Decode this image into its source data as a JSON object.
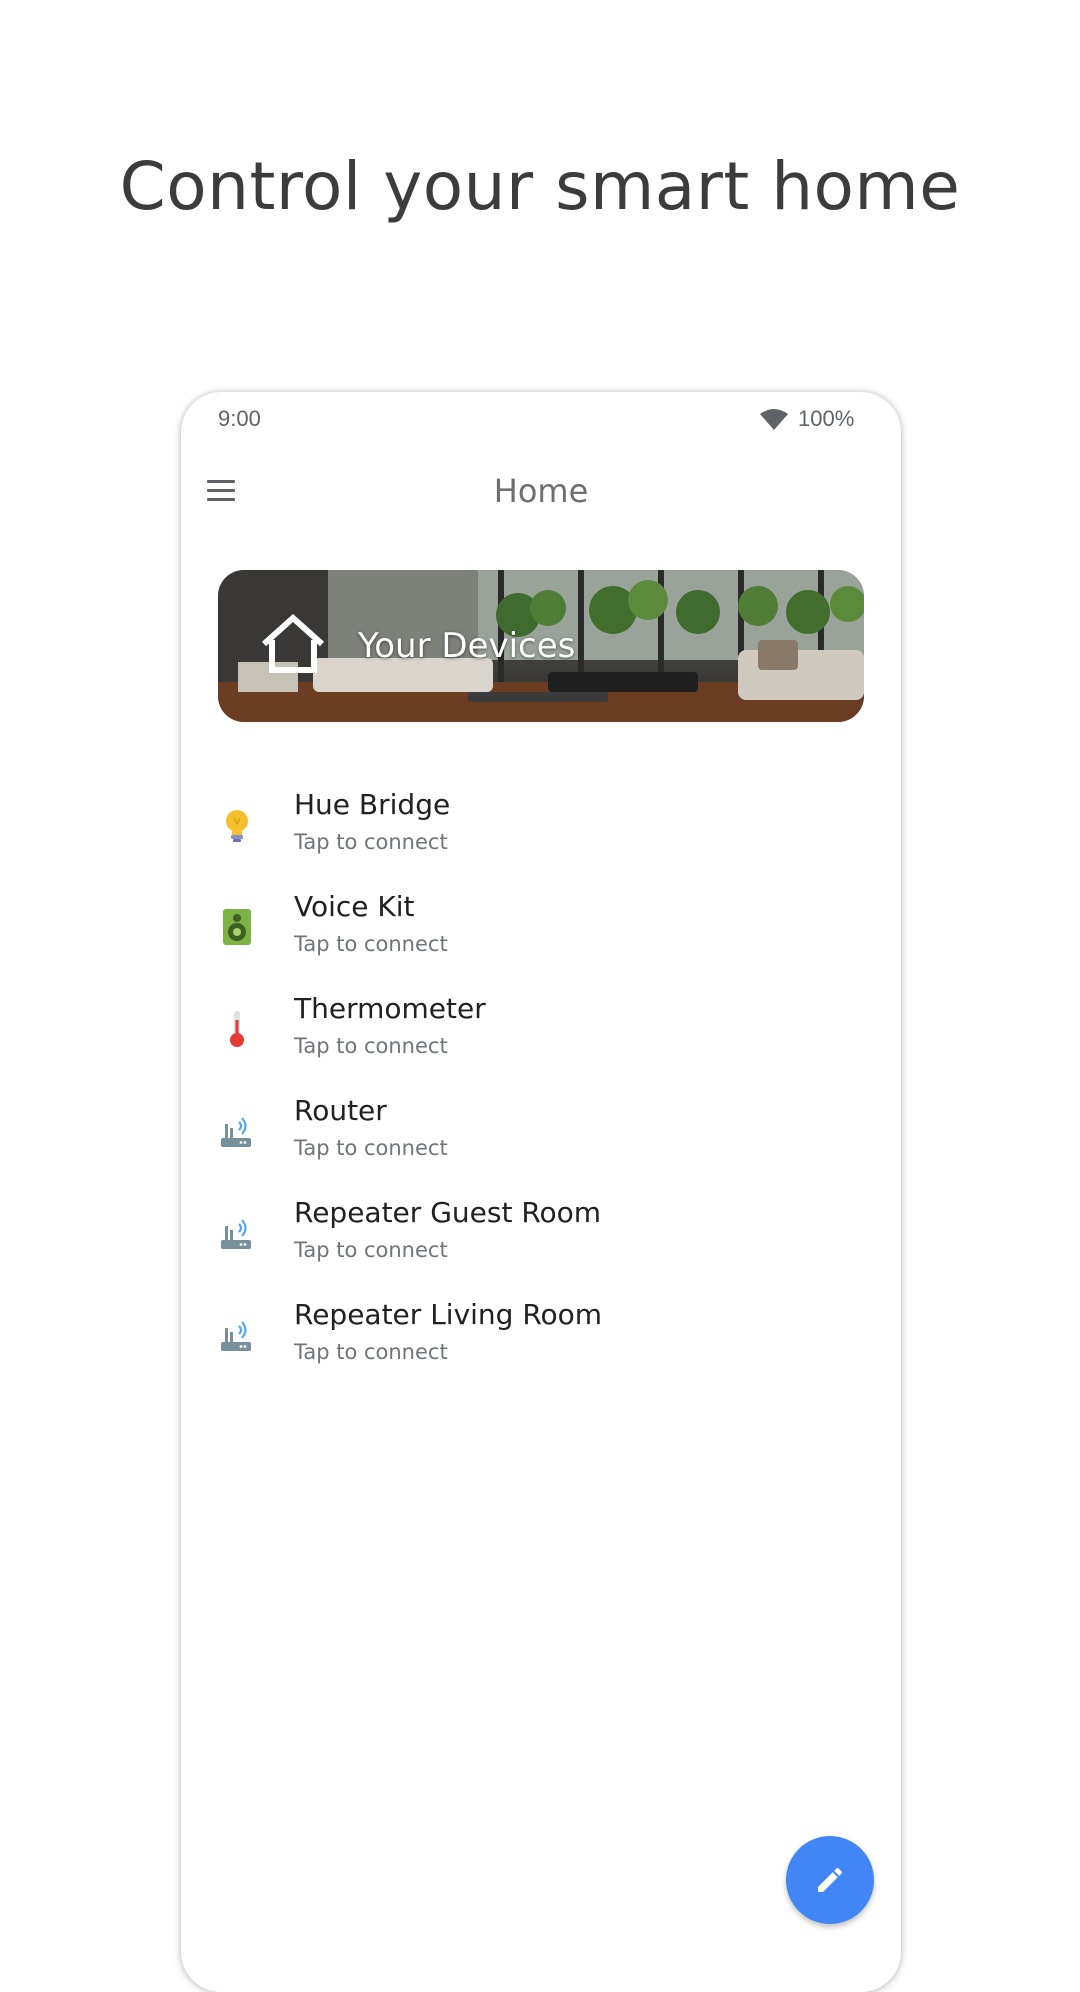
{
  "headline": "Control your smart home",
  "status_bar": {
    "time": "9:00",
    "battery": "100%"
  },
  "app_bar": {
    "title": "Home"
  },
  "banner": {
    "title": "Your Devices"
  },
  "devices": [
    {
      "name": "Hue Bridge",
      "subtitle": "Tap to connect",
      "icon": "lightbulb-icon"
    },
    {
      "name": "Voice Kit",
      "subtitle": "Tap to connect",
      "icon": "speaker-icon"
    },
    {
      "name": "Thermometer",
      "subtitle": "Tap to connect",
      "icon": "thermometer-icon"
    },
    {
      "name": "Router",
      "subtitle": "Tap to connect",
      "icon": "router-icon"
    },
    {
      "name": "Repeater Guest Room",
      "subtitle": "Tap to connect",
      "icon": "router-icon"
    },
    {
      "name": "Repeater Living Room",
      "subtitle": "Tap to connect",
      "icon": "router-icon"
    }
  ],
  "fab": {
    "icon": "edit-pencil-icon"
  },
  "colors": {
    "accent": "#4285f4",
    "text_primary": "#202124",
    "text_secondary": "#70757a"
  }
}
